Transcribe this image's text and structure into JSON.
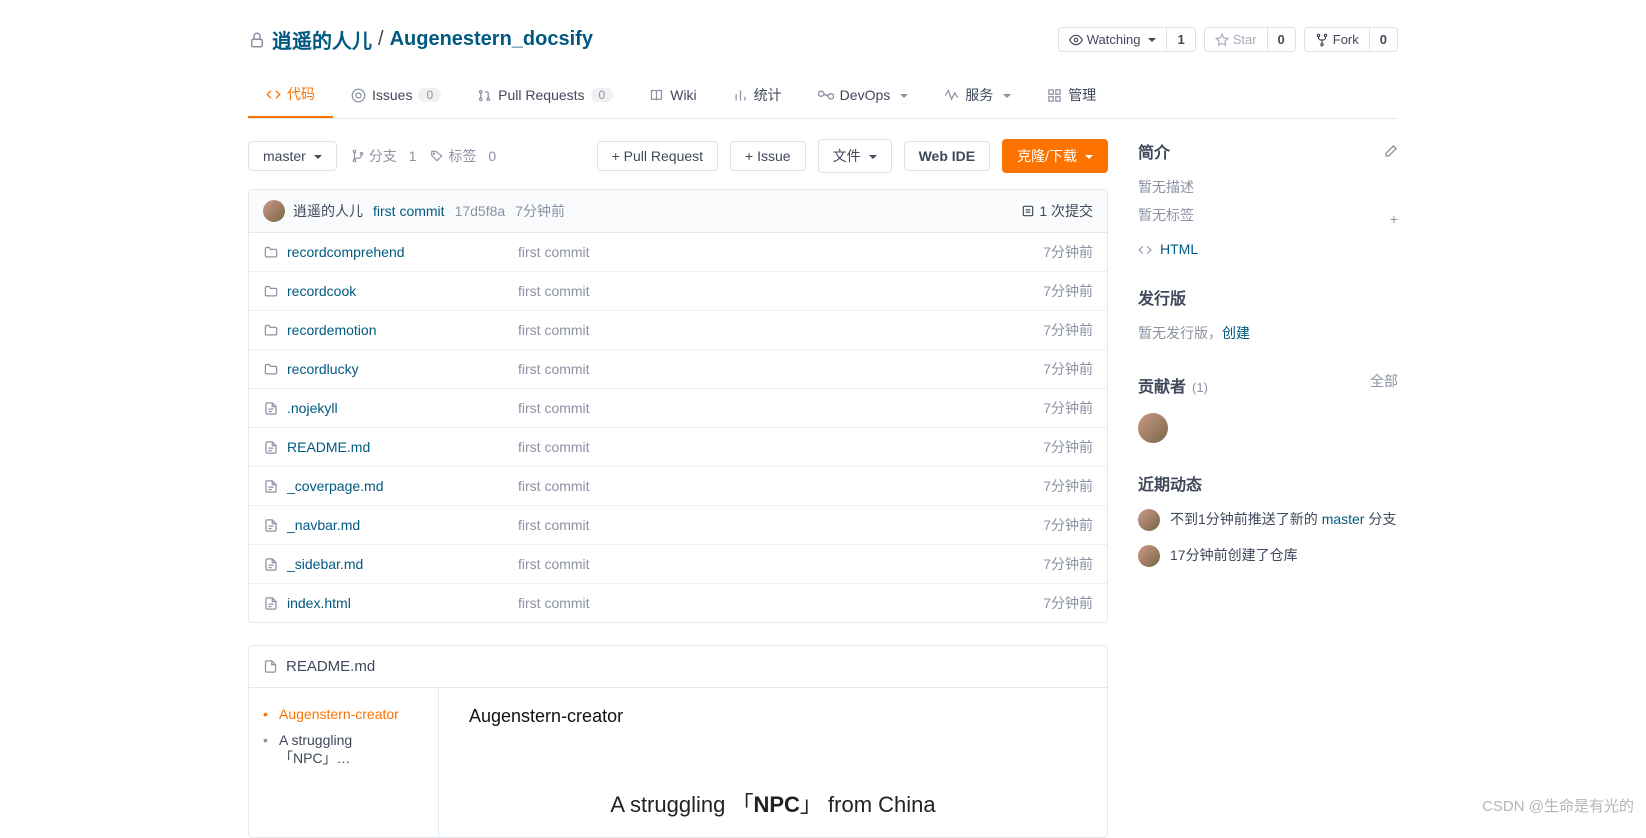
{
  "header": {
    "owner": "逍遥的人儿",
    "repo": "Augenestern_docsify",
    "watch_label": "Watching",
    "watch_count": "1",
    "star_label": "Star",
    "star_count": "0",
    "fork_label": "Fork",
    "fork_count": "0"
  },
  "tabs": {
    "code": "代码",
    "issues": "Issues",
    "issues_count": "0",
    "pr": "Pull Requests",
    "pr_count": "0",
    "wiki": "Wiki",
    "stats": "统计",
    "devops": "DevOps",
    "service": "服务",
    "manage": "管理"
  },
  "toolbar": {
    "branch": "master",
    "branches_label": "分支",
    "branches_count": "1",
    "tags_label": "标签",
    "tags_count": "0",
    "pr_btn": "+ Pull Request",
    "issue_btn": "+ Issue",
    "file_btn": "文件",
    "webide_btn": "Web IDE",
    "clone_btn": "克隆/下载"
  },
  "commit": {
    "author": "逍遥的人儿",
    "message": "first commit",
    "hash": "17d5f8a",
    "time": "7分钟前",
    "commits_label": "1 次提交"
  },
  "files": [
    {
      "type": "folder",
      "name": "recordcomprehend",
      "msg": "first commit",
      "time": "7分钟前"
    },
    {
      "type": "folder",
      "name": "recordcook",
      "msg": "first commit",
      "time": "7分钟前"
    },
    {
      "type": "folder",
      "name": "recordemotion",
      "msg": "first commit",
      "time": "7分钟前"
    },
    {
      "type": "folder",
      "name": "recordlucky",
      "msg": "first commit",
      "time": "7分钟前"
    },
    {
      "type": "file",
      "name": ".nojekyll",
      "msg": "first commit",
      "time": "7分钟前"
    },
    {
      "type": "file",
      "name": "README.md",
      "msg": "first commit",
      "time": "7分钟前"
    },
    {
      "type": "file",
      "name": "_coverpage.md",
      "msg": "first commit",
      "time": "7分钟前"
    },
    {
      "type": "file",
      "name": "_navbar.md",
      "msg": "first commit",
      "time": "7分钟前"
    },
    {
      "type": "file",
      "name": "_sidebar.md",
      "msg": "first commit",
      "time": "7分钟前"
    },
    {
      "type": "file",
      "name": "index.html",
      "msg": "first commit",
      "time": "7分钟前"
    }
  ],
  "readme": {
    "filename": "README.md",
    "toc": [
      {
        "label": "Augenstern-creator",
        "active": true
      },
      {
        "label": "A struggling 「NPC」…",
        "active": false
      }
    ],
    "h1": "Augenstern-creator",
    "tag_pre": "A struggling 「",
    "tag_bold": "NPC",
    "tag_post": "」 from China"
  },
  "sidebar": {
    "about_title": "简介",
    "about_empty": "暂无描述",
    "tags_empty": "暂无标签",
    "lang": "HTML",
    "release_title": "发行版",
    "release_empty": "暂无发行版，",
    "release_create": "创建",
    "contrib_title": "贡献者",
    "contrib_count": "(1)",
    "contrib_all": "全部",
    "activity_title": "近期动态",
    "act1_pre": "不到1分钟前推送了新的 ",
    "act1_link": "master",
    "act1_post": " 分支",
    "act2": "17分钟前创建了仓库"
  },
  "watermark": "CSDN @生命是有光的"
}
